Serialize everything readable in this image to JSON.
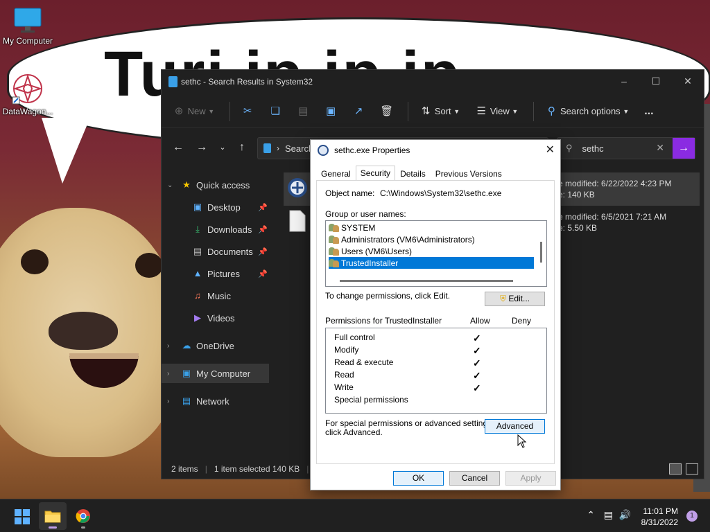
{
  "bubble_text": "Turi ip ip ip",
  "desktop_icons": [
    {
      "label": "My Computer"
    },
    {
      "label": "DataWagon..."
    }
  ],
  "explorer": {
    "title": "sethc - Search Results in System32",
    "toolbar": {
      "new": "New",
      "sort": "Sort",
      "view": "View",
      "search_options": "Search options",
      "more": "..."
    },
    "address": "Search",
    "search_value": "sethc",
    "nav": [
      {
        "label": "Quick access",
        "type": "section"
      },
      {
        "label": "Desktop",
        "pinned": true
      },
      {
        "label": "Downloads",
        "pinned": true
      },
      {
        "label": "Documents",
        "pinned": true
      },
      {
        "label": "Pictures",
        "pinned": true
      },
      {
        "label": "Music"
      },
      {
        "label": "Videos"
      },
      {
        "label": "OneDrive",
        "type": "section"
      },
      {
        "label": "My Computer",
        "type": "section",
        "selected": true
      },
      {
        "label": "Network",
        "type": "section"
      }
    ],
    "files": [
      {
        "modified": "e modified: 6/22/2022 4:23 PM",
        "size": "e: 140 KB",
        "selected": true
      },
      {
        "modified": "e modified: 6/5/2021 7:21 AM",
        "size": "e: 5.50 KB",
        "selected": false
      }
    ],
    "status": {
      "items": "2 items",
      "selected": "1 item selected  140 KB"
    }
  },
  "properties": {
    "title": "sethc.exe Properties",
    "tabs": [
      "General",
      "Security",
      "Details",
      "Previous Versions"
    ],
    "active_tab": "Security",
    "object_name_label": "Object name:",
    "object_name_value": "C:\\Windows\\System32\\sethc.exe",
    "group_label": "Group or user names:",
    "groups": [
      "SYSTEM",
      "Administrators (VM6\\Administrators)",
      "Users (VM6\\Users)",
      "TrustedInstaller"
    ],
    "selected_group": "TrustedInstaller",
    "change_text": "To change permissions, click Edit.",
    "edit_button": "Edit...",
    "perms_label": "Permissions for TrustedInstaller",
    "allow_label": "Allow",
    "deny_label": "Deny",
    "permissions": [
      {
        "name": "Full control",
        "allow": true
      },
      {
        "name": "Modify",
        "allow": true
      },
      {
        "name": "Read & execute",
        "allow": true
      },
      {
        "name": "Read",
        "allow": true
      },
      {
        "name": "Write",
        "allow": true
      },
      {
        "name": "Special permissions",
        "allow": false
      }
    ],
    "advanced_text_1": "For special permissions or advanced settings,",
    "advanced_text_2": "click Advanced.",
    "advanced_button": "Advanced",
    "ok": "OK",
    "cancel": "Cancel",
    "apply": "Apply"
  },
  "taskbar": {
    "time": "11:01 PM",
    "date": "8/31/2022",
    "notifications": "1"
  }
}
